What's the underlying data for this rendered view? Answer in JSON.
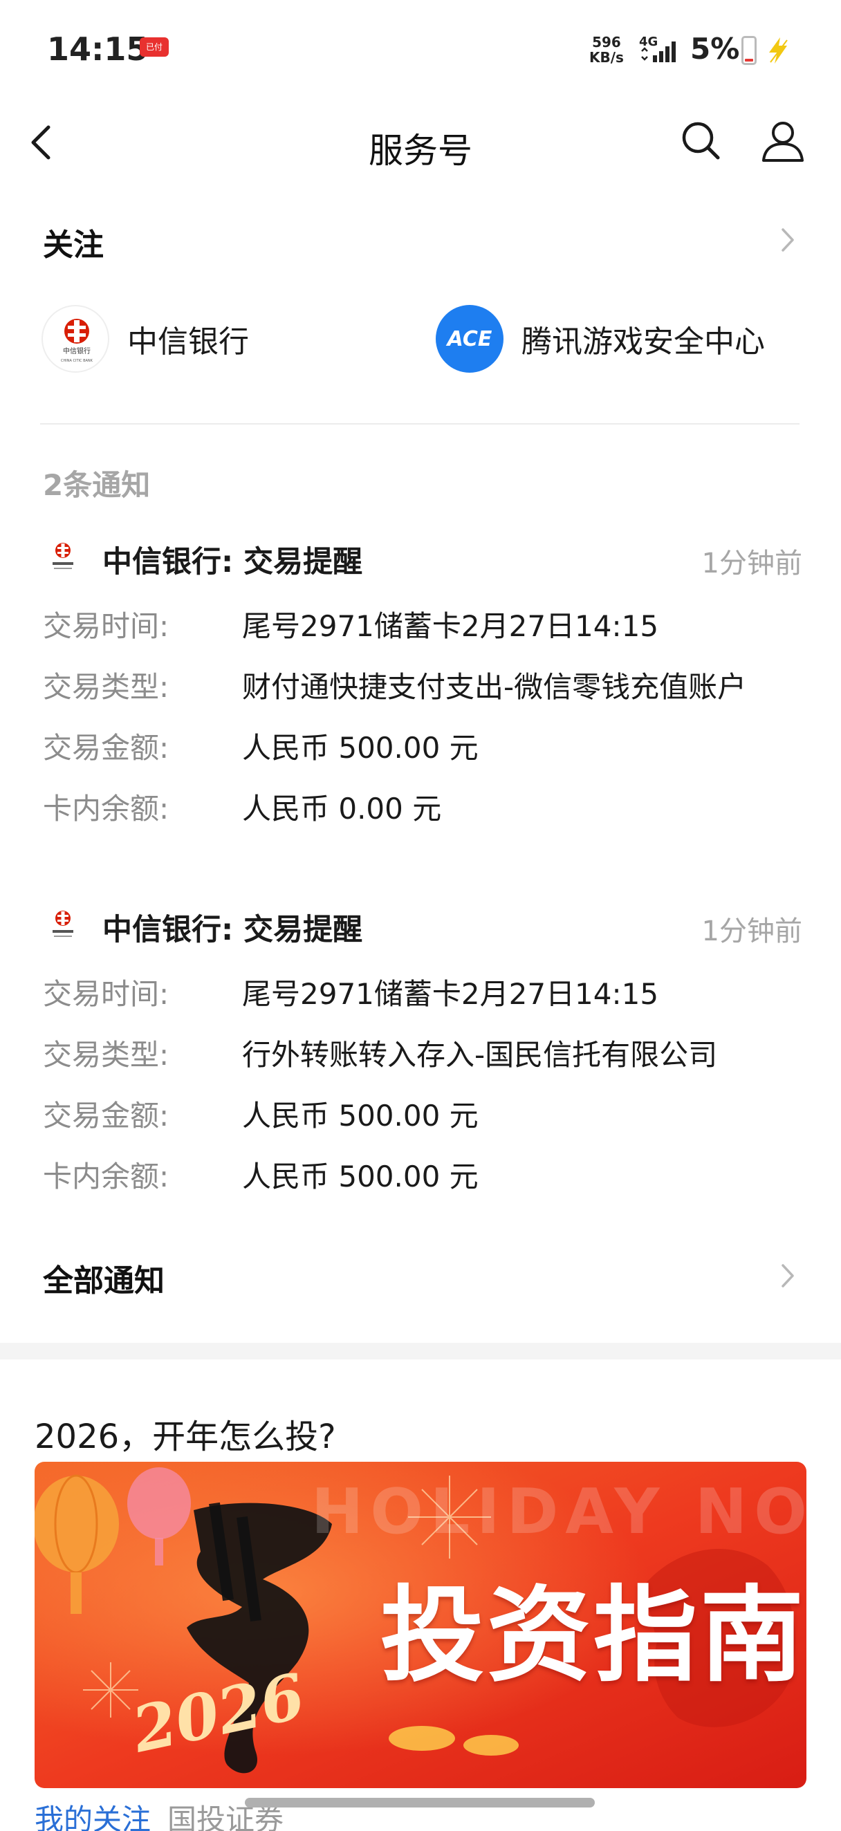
{
  "status_bar": {
    "time": "14:15",
    "app_badge": "已付",
    "net_speed_value": "596",
    "net_speed_unit": "KB/s",
    "network_type": "4G",
    "battery_percent": "5%",
    "icons": [
      "signal-icon",
      "battery-icon",
      "charging-icon"
    ]
  },
  "nav": {
    "title": "服务号",
    "icons": [
      "back-icon",
      "search-icon",
      "user-icon"
    ]
  },
  "follow": {
    "heading": "关注",
    "accounts": [
      {
        "name": "中信银行",
        "logo_text": "中信银行",
        "logo_subtext": "CHINA CITIC BANK"
      },
      {
        "name": "腾讯游戏安全中心",
        "logo_text": "ACE"
      }
    ]
  },
  "notifications": {
    "count_label": "2条通知",
    "items": [
      {
        "title": "中信银行: 交易提醒",
        "time": "1分钟前",
        "rows": [
          {
            "label": "交易时间:",
            "value": "尾号2971储蓄卡2月27日14:15"
          },
          {
            "label": "交易类型:",
            "value": "财付通快捷支付支出-微信零钱充值账户"
          },
          {
            "label": "交易金额:",
            "value": "人民币 500.00 元"
          },
          {
            "label": "卡内余额:",
            "value": "人民币 0.00 元"
          }
        ]
      },
      {
        "title": "中信银行: 交易提醒",
        "time": "1分钟前",
        "rows": [
          {
            "label": "交易时间:",
            "value": "尾号2971储蓄卡2月27日14:15"
          },
          {
            "label": "交易类型:",
            "value": "行外转账转入存入-国民信托有限公司"
          },
          {
            "label": "交易金额:",
            "value": "人民币 500.00 元"
          },
          {
            "label": "卡内余额:",
            "value": "人民币 500.00 元"
          }
        ]
      }
    ],
    "all_label": "全部通知"
  },
  "article": {
    "title": "2026，开年怎么投?",
    "banner_headline": "投资指南",
    "banner_watermark": "HOLIDAY NOTICE",
    "banner_year": "2026",
    "banner_char": "马"
  },
  "bottom_tabs": {
    "active": "我的关注",
    "other": "国投证券"
  },
  "colors": {
    "accent_blue": "#2a6fd6",
    "citic_red": "#d81e06",
    "ace_blue": "#1e7ef0",
    "banner_red": "#e8311d"
  }
}
